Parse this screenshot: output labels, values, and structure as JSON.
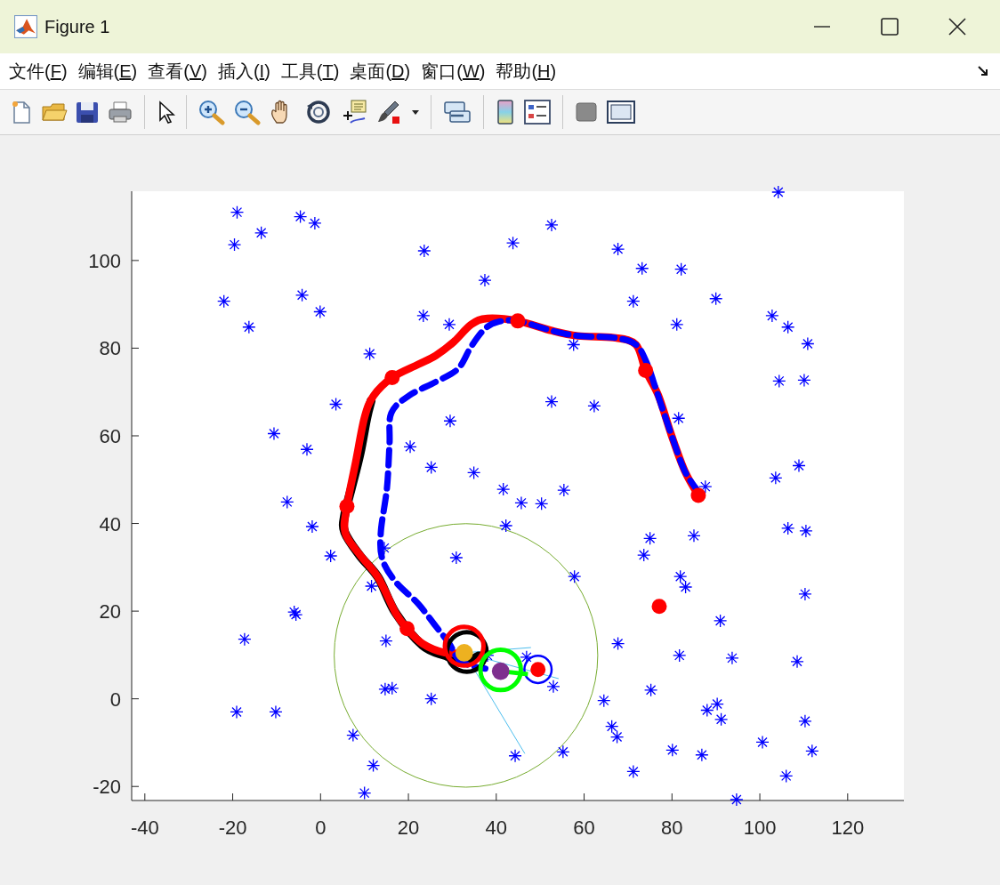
{
  "window": {
    "title": "Figure 1"
  },
  "menu": [
    {
      "before": "文件(",
      "mnemonic": "F",
      "after": ")"
    },
    {
      "before": "编辑(",
      "mnemonic": "E",
      "after": ")"
    },
    {
      "before": "查看(",
      "mnemonic": "V",
      "after": ")"
    },
    {
      "before": "插入(",
      "mnemonic": "I",
      "after": ")"
    },
    {
      "before": "工具(",
      "mnemonic": "T",
      "after": ")"
    },
    {
      "before": "桌面(",
      "mnemonic": "D",
      "after": ")"
    },
    {
      "before": "窗口(",
      "mnemonic": "W",
      "after": ")"
    },
    {
      "before": "帮助(",
      "mnemonic": "H",
      "after": ")"
    }
  ],
  "figure": {
    "chart_data": {
      "type": "scatter",
      "xlim": [
        -43,
        132.8
      ],
      "ylim": [
        -23.2,
        115.8
      ],
      "xticks": [
        -40,
        -20,
        0,
        20,
        40,
        60,
        80,
        100,
        120
      ],
      "yticks": [
        -20,
        0,
        20,
        40,
        60,
        80,
        100
      ],
      "series": [
        {
          "type": "scatter",
          "color": "#0000ff",
          "x": [
            -19,
            -19.6,
            -13.5,
            -4.6,
            -1.3,
            -22,
            -16.3,
            -4.2,
            -0.1,
            23.6,
            37.4,
            43.8,
            52.6,
            67.7,
            73.2,
            82.1,
            90,
            71.2,
            81.1,
            102.8,
            106.4,
            110.9,
            104.2,
            23.4,
            29.3,
            57.6,
            11.2,
            3.5,
            52.6,
            62.3,
            81.5,
            104.4,
            110.1,
            -10.6,
            20.4,
            29.5,
            -3.1,
            25.2,
            34.9,
            41.6,
            45.7,
            50.3,
            55.4,
            87.6,
            103.6,
            108.9,
            -7.6,
            -1.9,
            42.2,
            106.4,
            110.5,
            75,
            85,
            73.6,
            2.3,
            30.9,
            14.5,
            11.6,
            57.8,
            81.9,
            83.1,
            110.3,
            -6,
            -5.6,
            -17.3,
            14.9,
            67.7,
            91,
            81.7,
            93.7,
            108.5,
            46.9,
            38,
            -19.1,
            -10.2,
            14.7,
            16.3,
            25.2,
            53,
            64.5,
            75.2,
            88,
            90.3,
            91.2,
            110.3,
            66.3,
            67.5,
            7.4,
            44.3,
            55.2,
            80.1,
            86.8,
            100.6,
            111.9,
            12,
            71.2,
            106,
            10,
            94.7
          ],
          "values": [
            111,
            103.6,
            106.3,
            110,
            108.5,
            90.7,
            84.8,
            92.1,
            88.3,
            102.2,
            95.5,
            104,
            108.1,
            102.6,
            98.2,
            98,
            91.3,
            90.7,
            85.4,
            87.4,
            84.8,
            81,
            115.6,
            87.4,
            85.4,
            80.8,
            78.7,
            67.2,
            67.8,
            66.8,
            64,
            72.5,
            72.7,
            60.5,
            57.5,
            63.4,
            56.9,
            52.8,
            51.6,
            47.8,
            44.7,
            44.5,
            47.6,
            48.4,
            50.4,
            53.2,
            44.9,
            39.3,
            39.5,
            38.9,
            38.3,
            36.6,
            37.2,
            32.8,
            32.6,
            32.2,
            34.4,
            25.7,
            27.9,
            27.9,
            25.5,
            23.9,
            19.8,
            19.2,
            13.6,
            13.2,
            12.6,
            17.8,
            9.9,
            9.3,
            8.5,
            9.5,
            9.9,
            -3,
            -3,
            2.2,
            2.4,
            0,
            2.8,
            -0.4,
            2,
            -2.6,
            -1.2,
            -4.7,
            -5.1,
            -6.3,
            -8.7,
            -8.3,
            -13,
            -12.1,
            -11.7,
            -12.8,
            -9.9,
            -11.9,
            -15.2,
            -16.6,
            -17.6,
            -21.5,
            -23
          ]
        },
        {
          "type": "line",
          "line_style": "solid",
          "color": "#000000",
          "x": [
            11.5,
            10.5,
            9,
            7,
            5.5,
            5.5,
            9,
            13.1,
            17.1,
            23.2,
            28.3,
            33,
            36
          ],
          "values": [
            68,
            64,
            56,
            48,
            42,
            38,
            32.6,
            27.7,
            19.6,
            12.2,
            9.9,
            8.6,
            9.8
          ]
        },
        {
          "type": "line",
          "line_style": "dashed",
          "color": "#0000ff",
          "x": [
            86.2,
            82.9,
            79.9,
            76.5,
            74.4,
            71.8,
            66.7,
            58.6,
            52.6,
            44.9,
            40.4,
            37.4,
            34.3,
            31.3,
            26.2,
            20.2,
            16.1,
            15.7,
            15.1,
            13.7,
            14.1,
            17.1,
            22.2,
            26.2,
            29.3,
            31.3,
            34.3,
            37.5
          ],
          "values": [
            47,
            52,
            60.1,
            70.2,
            76.3,
            80.8,
            82.4,
            82.8,
            84,
            86.2,
            86,
            84.4,
            80.4,
            75.3,
            72.3,
            69.2,
            65.2,
            58.1,
            48,
            37.9,
            31.8,
            26.7,
            21.7,
            16.6,
            12.6,
            9.1,
            7.5,
            6.9
          ]
        },
        {
          "type": "line",
          "line_style": "solid",
          "color": "#ff0000",
          "x": [
            86,
            82.9,
            79.9,
            76.9,
            74,
            71.8,
            66.7,
            58.6,
            52.6,
            44.9,
            38,
            34.3,
            30.3,
            26.2,
            22.2,
            16.3,
            12.1,
            10,
            8,
            6,
            5.6,
            9,
            13.1,
            17.1,
            19.7,
            23.2,
            28.3,
            32.3
          ],
          "values": [
            46.4,
            52,
            60.1,
            69.2,
            74.9,
            80.8,
            82.4,
            82.8,
            84,
            86.2,
            86.8,
            85.4,
            81.4,
            78.3,
            76.3,
            73.3,
            69.2,
            64.2,
            54,
            43.9,
            37.9,
            32.8,
            27.7,
            19.6,
            16,
            12.6,
            10.5,
            10.5
          ]
        },
        {
          "type": "scatter",
          "color": "#ff0000",
          "x": [
            86,
            74,
            44.9,
            16.3,
            6,
            19.7,
            77.1,
            49.5
          ],
          "values": [
            46.4,
            74.9,
            86.2,
            73.3,
            43.9,
            16,
            21.1,
            6.7
          ]
        }
      ]
    }
  }
}
